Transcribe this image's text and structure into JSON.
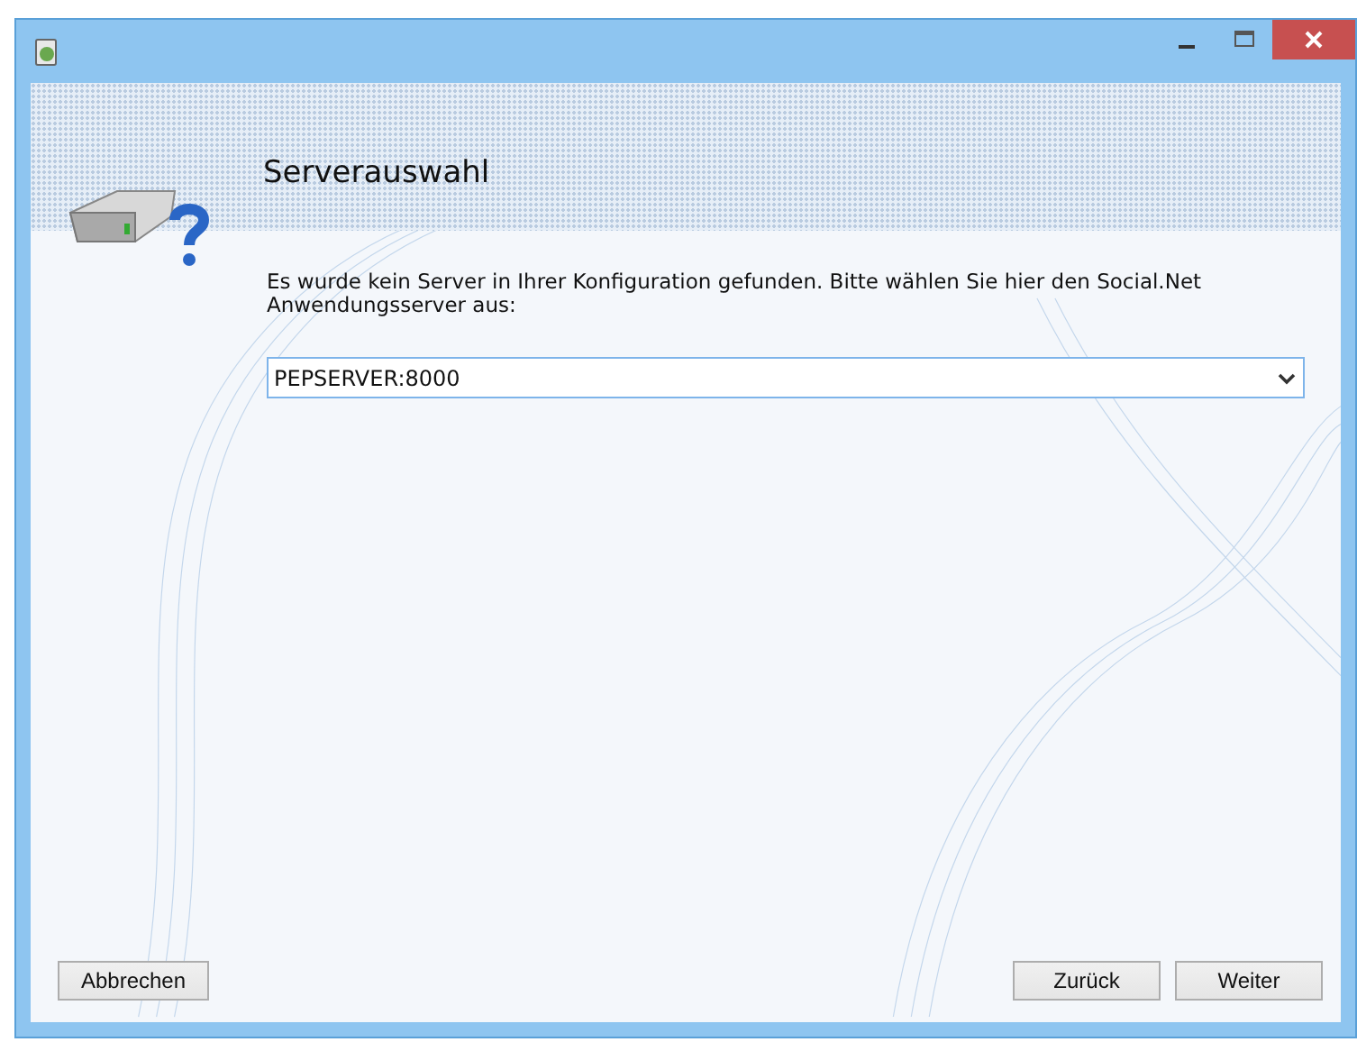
{
  "header": {
    "title": "Serverauswahl"
  },
  "message": "Es wurde kein Server in Ihrer Konfiguration gefunden. Bitte wählen Sie hier den Social.Net Anwendungsserver aus:",
  "server_combo": {
    "value": "PEPSERVER:8000"
  },
  "buttons": [
    {
      "label": "Abbrechen",
      "kind": "cancel"
    },
    {
      "label": "Zurück",
      "kind": "nav"
    },
    {
      "label": "Weiter",
      "kind": "nav"
    }
  ]
}
